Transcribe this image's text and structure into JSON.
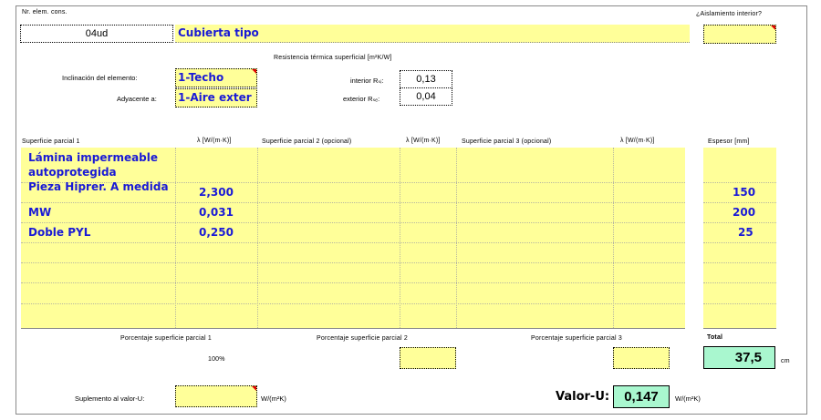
{
  "header": {
    "nr_label": "Nr. elem. cons.",
    "nr_value": "04ud",
    "name_value": "Cubierta tipo",
    "aislamiento_label": "¿Aislamiento interior?",
    "aislamiento_value": ""
  },
  "resistencias": {
    "title": "Resistencia térmica superficial [m²K/W]",
    "interior_label": "interior Rₛᵢ:",
    "interior_value": "0,13",
    "exterior_label": "exterior Rₛₑ:",
    "exterior_value": "0,04"
  },
  "element": {
    "inclinacion_label": "Inclinación del elemento:",
    "inclinacion_value": "1-Techo",
    "adyacente_label": "Adyacente a:",
    "adyacente_value": "1-Aire exter"
  },
  "table": {
    "headers": {
      "sp1": "Superficie parcial 1",
      "lambda1": "λ [W/(m·K)]",
      "sp2": "Superficie parcial 2 (opcional)",
      "lambda2": "λ [W/(m·K)]",
      "sp3": "Superficie parcial 3 (opcional)",
      "lambda3": "λ [W/(m·K)]",
      "espesor": "Espesor [mm]"
    },
    "rows": [
      {
        "material": "Lámina impermeable autoprotegida",
        "lambda": "",
        "espesor": ""
      },
      {
        "material": "Pieza Hiprer. A medida",
        "lambda": "2,300",
        "espesor": "150"
      },
      {
        "material": "MW",
        "lambda": "0,031",
        "espesor": "200"
      },
      {
        "material": "Doble PYL",
        "lambda": "0,250",
        "espesor": "25"
      }
    ]
  },
  "porcentajes": {
    "p1_label": "Porcentaje superficie parcial 1",
    "p1_value": "100%",
    "p2_label": "Porcentaje superficie parcial 2",
    "p3_label": "Porcentaje superficie parcial 3",
    "total_label": "Total",
    "total_value": "37,5",
    "total_unit": "cm"
  },
  "footer": {
    "suplemento_label": "Suplemento al valor-U:",
    "suplemento_unit": "W/(m²K)",
    "valor_u_label": "Valor-U:",
    "valor_u_value": "0,147",
    "valor_u_unit": "W/(m²K)"
  },
  "colors": {
    "input_bg": "#ffff99",
    "result_bg": "#a9f7cf",
    "text_blue": "#1a1ad6"
  }
}
